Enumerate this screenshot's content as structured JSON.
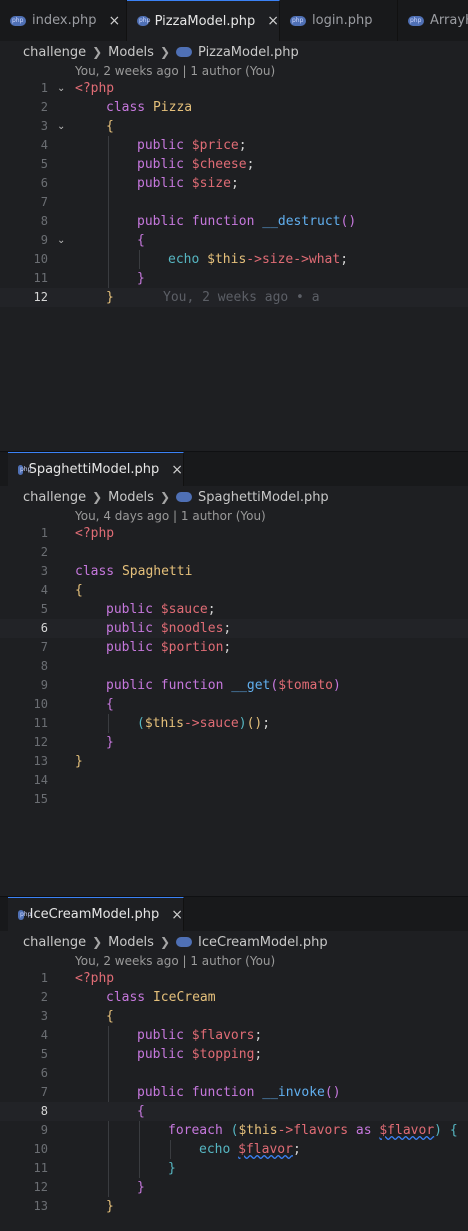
{
  "groups": [
    {
      "tabs": [
        {
          "label": "index.php",
          "active": false,
          "close": "×"
        },
        {
          "label": "PizzaModel.php",
          "active": true,
          "close": "×"
        },
        {
          "label": "login.php",
          "active": false,
          "close": ""
        },
        {
          "label": "ArrayH",
          "active": false,
          "close": ""
        }
      ],
      "breadcrumb": [
        "challenge",
        "Models",
        "PizzaModel.php"
      ],
      "blame_header": "You, 2 weeks ago | 1 author (You)",
      "current_line": 12,
      "inline_blame": "You, 2 weeks ago • a",
      "lines": [
        "1",
        "2",
        "3",
        "4",
        "5",
        "6",
        "7",
        "8",
        "9",
        "10",
        "11",
        "12"
      ]
    },
    {
      "tabs": [
        {
          "label": "SpaghettiModel.php",
          "active": true,
          "close": "×"
        }
      ],
      "breadcrumb": [
        "challenge",
        "Models",
        "SpaghettiModel.php"
      ],
      "blame_header": "You, 4 days ago | 1 author (You)",
      "current_line": 6,
      "lines": [
        "1",
        "2",
        "3",
        "4",
        "5",
        "6",
        "7",
        "8",
        "9",
        "10",
        "11",
        "12",
        "13",
        "14",
        "15"
      ]
    },
    {
      "tabs": [
        {
          "label": "IceCreamModel.php",
          "active": true,
          "close": "×"
        }
      ],
      "breadcrumb": [
        "challenge",
        "Models",
        "IceCreamModel.php"
      ],
      "blame_header": "You, 2 weeks ago | 1 author (You)",
      "current_line": 8,
      "lines": [
        "1",
        "2",
        "3",
        "4",
        "5",
        "6",
        "7",
        "8",
        "9",
        "10",
        "11",
        "12",
        "13"
      ]
    }
  ],
  "code": {
    "php_open": "<?php",
    "class": "class",
    "public": "public",
    "function": "function",
    "echo": "echo",
    "foreach": "foreach",
    "as": "as",
    "pizza": "Pizza",
    "spaghetti": "Spaghetti",
    "icecream": "IceCream",
    "price": "$price",
    "cheese": "$cheese",
    "size": "$size",
    "sauce": "$sauce",
    "noodles": "$noodles",
    "portion": "$portion",
    "flavors": "$flavors",
    "topping": "$topping",
    "destruct": "__destruct",
    "get": "__get",
    "invoke": "__invoke",
    "this": "$this",
    "tomato": "$tomato",
    "flavor": "$flavor",
    "prop_size": "size",
    "prop_what": "what",
    "prop_sauce": "sauce",
    "prop_flavors": "flavors"
  },
  "icons": {
    "php_file": "php-file-icon",
    "close": "close-icon",
    "chevron": "chevron-right-icon",
    "fold": "fold-chevron-icon"
  }
}
